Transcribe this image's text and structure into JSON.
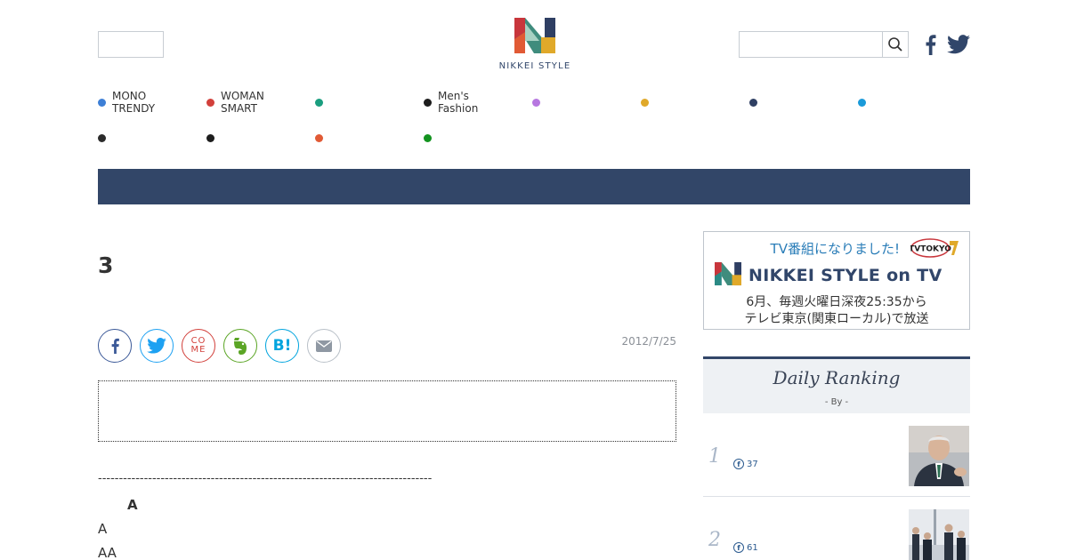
{
  "header": {
    "brand": "NIKKEI STYLE",
    "search_placeholder": ""
  },
  "nav": {
    "row1": [
      {
        "label": "MONO\nTRENDY",
        "color": "#3d7fd6"
      },
      {
        "label": "WOMAN\nSMART",
        "color": "#d2403b"
      },
      {
        "label": "",
        "color": "#1a9e7f"
      },
      {
        "label": "Men's\nFashion",
        "color": "#1d1d1d"
      },
      {
        "label": "",
        "color": "#b777e0"
      },
      {
        "label": "",
        "color": "#e0a92a"
      },
      {
        "label": "",
        "color": "#2f3f63"
      },
      {
        "label": "",
        "color": "#1a9ad9"
      }
    ],
    "row2": [
      {
        "label": "",
        "color": "#2b2b2b"
      },
      {
        "label": "",
        "color": "#1d1d1d"
      },
      {
        "label": "",
        "color": "#e15a35"
      },
      {
        "label": "",
        "color": "#13931f"
      }
    ]
  },
  "article": {
    "title": "3",
    "date": "2012/7/25",
    "dashes": "--------------------------------------------------------------------------------",
    "line1": "A",
    "line2": "A",
    "line3": "AA"
  },
  "share": {
    "facebook": "f",
    "comment": "CO\nME",
    "hatena": "B!"
  },
  "banner": {
    "line1": "TV番組になりました!",
    "tv_brand": "TVTOKYO",
    "line2": "NIKKEI STYLE on TV",
    "line3": "6月、毎週火曜日深夜25:35から",
    "line4": "テレビ東京(関東ローカル)で放送"
  },
  "ranking": {
    "title": "Daily Ranking",
    "subtitle": "- By  -",
    "items": [
      {
        "rank": "1",
        "shares": "37"
      },
      {
        "rank": "2",
        "shares": "61"
      }
    ]
  },
  "colors": {
    "accent": "#324668",
    "facebook": "#3b5998",
    "twitter": "#1da1f2",
    "evernote": "#5ba525",
    "hatena": "#00a4de"
  }
}
